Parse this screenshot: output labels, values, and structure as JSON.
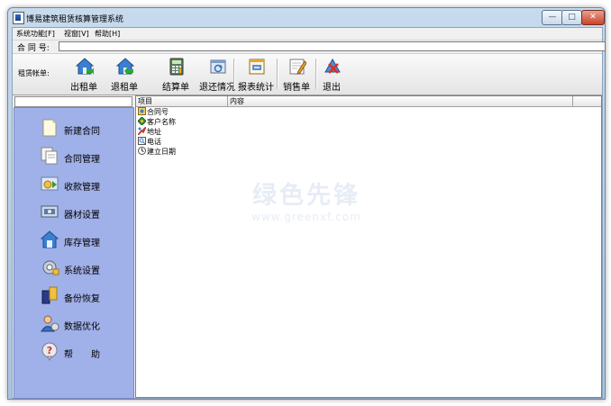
{
  "window": {
    "title": "博易建筑租赁核算管理系统",
    "controls": {
      "minimize": "—",
      "maximize": "□",
      "close": "✕"
    }
  },
  "menu": [
    "系统功能[F]",
    "视窗[V]",
    "帮助[H]"
  ],
  "contract": {
    "label": "合 同 号:",
    "value": ""
  },
  "toolbar": {
    "label": "租赁帐单:",
    "buttons": [
      {
        "label": "出租单",
        "icon": "house-export-icon"
      },
      {
        "label": "退租单",
        "icon": "house-return-icon"
      },
      {
        "label": "结算单",
        "icon": "calculator-icon"
      },
      {
        "label": "退还情况",
        "icon": "return-status-icon"
      },
      {
        "label": "报表统计",
        "icon": "report-icon"
      },
      {
        "label": "销售单",
        "icon": "sales-note-icon"
      },
      {
        "label": "退出",
        "icon": "exit-icon"
      }
    ]
  },
  "sidebar": {
    "items": [
      {
        "label": "新建合同",
        "icon": "new-document-icon"
      },
      {
        "label": "合同管理",
        "icon": "documents-icon"
      },
      {
        "label": "收款管理",
        "icon": "payment-icon"
      },
      {
        "label": "器材设置",
        "icon": "equipment-icon"
      },
      {
        "label": "库存管理",
        "icon": "warehouse-icon"
      },
      {
        "label": "系统设置",
        "icon": "settings-icon"
      },
      {
        "label": "备份恢复",
        "icon": "backup-icon"
      },
      {
        "label": "数据优化",
        "icon": "optimize-icon"
      },
      {
        "label": "帮　　助",
        "icon": "help-icon"
      }
    ]
  },
  "grid": {
    "columns": [
      "项目",
      "内容"
    ],
    "rows": [
      {
        "item": "合同号",
        "icon": "contract-icon"
      },
      {
        "item": "客户名称",
        "icon": "customer-icon"
      },
      {
        "item": "地址",
        "icon": "address-icon"
      },
      {
        "item": "电话",
        "icon": "phone-icon"
      },
      {
        "item": "建立日期",
        "icon": "date-icon"
      }
    ]
  },
  "watermark": {
    "line1": "绿色先锋",
    "line2": "www.greenxf.com"
  },
  "colors": {
    "sidebar": "#a0b0e8",
    "title_gradient": "#c7daee"
  }
}
